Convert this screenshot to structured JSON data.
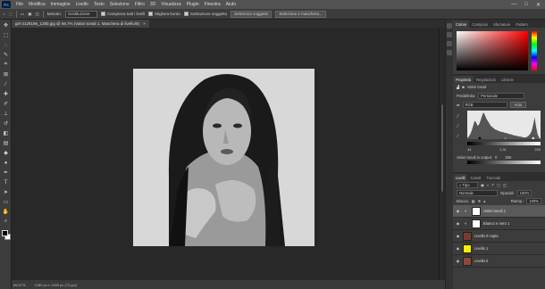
{
  "app": {
    "logo": "Ps"
  },
  "menu": [
    "File",
    "Modifica",
    "Immagine",
    "Livello",
    "Testo",
    "Selezione",
    "Filtro",
    "3D",
    "Visualizza",
    "Plugin",
    "Finestra",
    "Aiuto"
  ],
  "window_controls": [
    "—",
    "□",
    "✕"
  ],
  "options": {
    "mode_label": "Metodo:",
    "mode_value": "Sostituzione",
    "sample_all_layers": "Campiona tutti i livelli",
    "enhance_edge": "Migliora bordo",
    "subtract_subject": "Sottrazione soggetto",
    "select_subject": "Seleziona soggetto",
    "select_and_mask": "Selezione e maschera..."
  },
  "document": {
    "tab_title": "girl-2128196_1280.jpg @ 66,7% (Valori tonali 1, Maschera di livello/8)",
    "close": "×"
  },
  "status": {
    "zoom": "66,67%",
    "info": "1280 px x 1280 px (72 ppi)"
  },
  "color_panel": {
    "tabs": [
      "Colore",
      "Campioni",
      "Sfumature",
      "Pattern"
    ]
  },
  "properties": {
    "tabs": [
      "Proprietà",
      "Regolazioni",
      "Librerie"
    ],
    "title": "Valori tonali",
    "preset_label": "Predefinito:",
    "preset_value": "Personale",
    "channel": "RGB",
    "auto_button": "Auto",
    "input_low": "44",
    "input_mid": "1,31",
    "input_high": "230",
    "output_label": "Valori tonali in output:",
    "output_low": "0",
    "output_high": "255",
    "histogram": [
      2,
      4,
      8,
      14,
      22,
      30,
      28,
      22,
      24,
      30,
      38,
      44,
      40,
      34,
      30,
      26,
      22,
      20,
      18,
      16,
      15,
      14,
      13,
      12,
      12,
      11,
      10,
      10,
      9,
      8,
      8,
      7,
      6,
      6,
      5,
      5,
      4,
      4,
      3,
      3,
      3,
      4,
      6,
      9,
      14,
      24,
      36,
      20,
      8,
      3
    ]
  },
  "layers_panel": {
    "tabs": [
      "Livelli",
      "Canali",
      "Tracciati"
    ],
    "kind_label": "Tipo",
    "blend_mode": "Normale",
    "opacity_label": "Opacità:",
    "opacity_value": "100%",
    "lock_label": "Blocca:",
    "fill_label": "Riemp.:",
    "fill_value": "100%",
    "layers": [
      {
        "name": "Valori tonali 1",
        "kind": "adjustment",
        "active": true,
        "thumb": "#ffffff"
      },
      {
        "name": "Bianco e nero 1",
        "kind": "adjustment",
        "active": false,
        "thumb": "#ffffff"
      },
      {
        "name": "Livello 0 copia",
        "kind": "pixel",
        "active": false,
        "thumb": "#7a3a2a"
      },
      {
        "name": "Livello 1",
        "kind": "pixel",
        "active": false,
        "thumb": "#ffee00"
      },
      {
        "name": "Livello 0",
        "kind": "pixel",
        "active": false,
        "thumb": "#8a4a3a"
      }
    ]
  }
}
